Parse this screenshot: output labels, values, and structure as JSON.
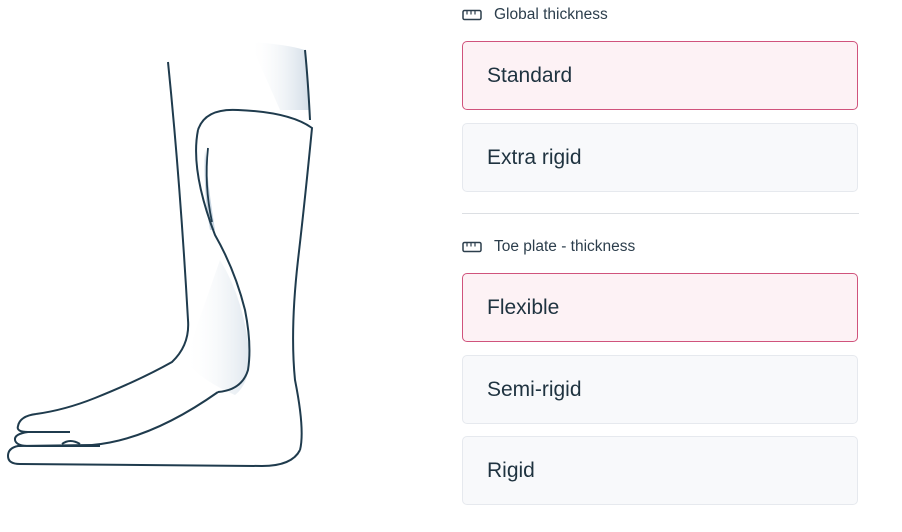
{
  "sections": [
    {
      "label": "Global thickness",
      "icon": "ruler-icon",
      "options": [
        {
          "label": "Standard",
          "selected": true
        },
        {
          "label": "Extra rigid",
          "selected": false
        }
      ]
    },
    {
      "label": "Toe plate - thickness",
      "icon": "ruler-icon",
      "options": [
        {
          "label": "Flexible",
          "selected": true
        },
        {
          "label": "Semi-rigid",
          "selected": false
        },
        {
          "label": "Rigid",
          "selected": false
        }
      ]
    }
  ],
  "colors": {
    "accent": "#d0537c",
    "selected_bg": "#fdf2f5",
    "unselected_bg": "#f8f9fb",
    "text": "#1f3340",
    "line_art": "#1f3b4d"
  }
}
